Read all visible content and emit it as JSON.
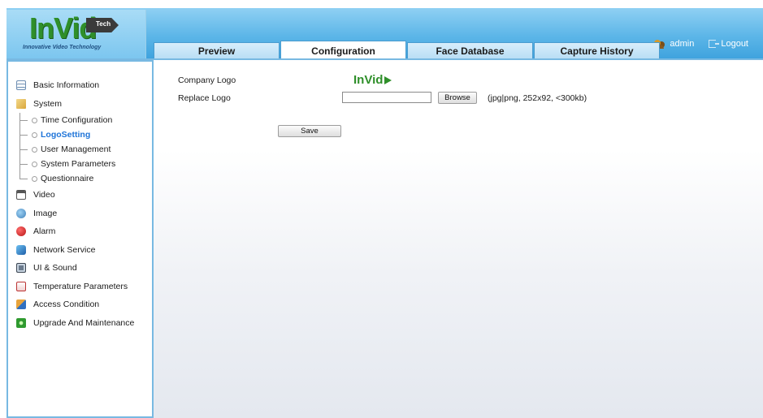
{
  "brand": {
    "logo_text": "InVid",
    "logo_tag": "Tech",
    "logo_subtitle": "Innovative Video Technology",
    "colors": {
      "header": "#5db6e8",
      "logo_green": "#2f8f2a",
      "active_link": "#1e74d8"
    }
  },
  "user": {
    "name": "admin",
    "logout_label": "Logout",
    "icon": "users-icon",
    "logout_icon": "logout-icon"
  },
  "tabs": [
    {
      "label": "Preview"
    },
    {
      "label": "Configuration",
      "active": true
    },
    {
      "label": "Face Database"
    },
    {
      "label": "Capture History"
    }
  ],
  "sidebar": {
    "items": [
      {
        "label": "Basic Information",
        "icon": "info-list-icon"
      },
      {
        "label": "System",
        "icon": "system-folder-icon"
      },
      {
        "label": "Video",
        "icon": "video-icon"
      },
      {
        "label": "Image",
        "icon": "image-icon"
      },
      {
        "label": "Alarm",
        "icon": "alarm-icon"
      },
      {
        "label": "Network Service",
        "icon": "network-icon"
      },
      {
        "label": "UI & Sound",
        "icon": "ui-sound-icon"
      },
      {
        "label": "Temperature Parameters",
        "icon": "temperature-icon"
      },
      {
        "label": "Access Condition",
        "icon": "access-icon"
      },
      {
        "label": "Upgrade And Maintenance",
        "icon": "upgrade-icon"
      }
    ],
    "system_children": [
      {
        "label": "Time Configuration"
      },
      {
        "label": "LogoSetting",
        "active": true
      },
      {
        "label": "User Management"
      },
      {
        "label": "System Parameters"
      },
      {
        "label": "Questionnaire"
      }
    ]
  },
  "logo_setting": {
    "company_logo_label": "Company Logo",
    "company_logo_text": "InVid",
    "replace_logo_label": "Replace Logo",
    "file_value": "",
    "browse_label": "Browse",
    "hint": "(jpg|png, 252x92, <300kb)",
    "save_label": "Save"
  }
}
